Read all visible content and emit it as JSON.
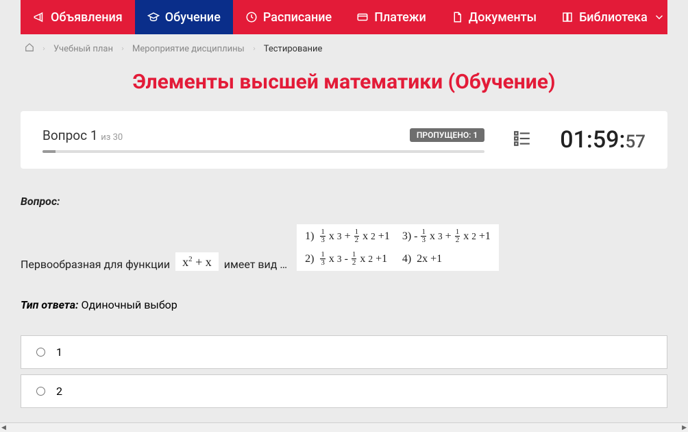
{
  "nav": [
    {
      "id": "announcements",
      "label": "Объявления",
      "icon": "megaphone"
    },
    {
      "id": "learning",
      "label": "Обучение",
      "icon": "gradcap",
      "active": true
    },
    {
      "id": "schedule",
      "label": "Расписание",
      "icon": "clock"
    },
    {
      "id": "payments",
      "label": "Платежи",
      "icon": "card"
    },
    {
      "id": "documents",
      "label": "Документы",
      "icon": "doc"
    },
    {
      "id": "library",
      "label": "Библиотека",
      "icon": "book",
      "dropdown": true
    }
  ],
  "breadcrumbs": {
    "items": [
      {
        "label": "Учебный план",
        "link": true
      },
      {
        "label": "Мероприятие дисциплины",
        "link": true
      },
      {
        "label": "Тестирование",
        "link": false
      }
    ]
  },
  "page_title": "Элементы высшей математики (Обучение)",
  "status": {
    "question_word": "Вопрос",
    "current": "1",
    "of_word": "из",
    "total": "30",
    "skipped_label": "ПРОПУЩЕНО:",
    "skipped_count": "1",
    "timer_main": "01:59:",
    "timer_sec": "57"
  },
  "question": {
    "heading": "Вопрос:",
    "prefix": "Первообразная для функции",
    "inline_formula": "x² + x",
    "suffix": "имеет вид …",
    "options_math": {
      "1": "(1/3)x³ + (1/2)x² + 1",
      "2": "(1/3)x³ - (1/2)x² + 1",
      "3": "-(1/3)x³ + (1/2)x² + 1",
      "4": "2x + 1"
    }
  },
  "answer_type": {
    "label": "Тип ответа:",
    "value": "Одиночный выбор"
  },
  "answers": [
    "1",
    "2"
  ]
}
